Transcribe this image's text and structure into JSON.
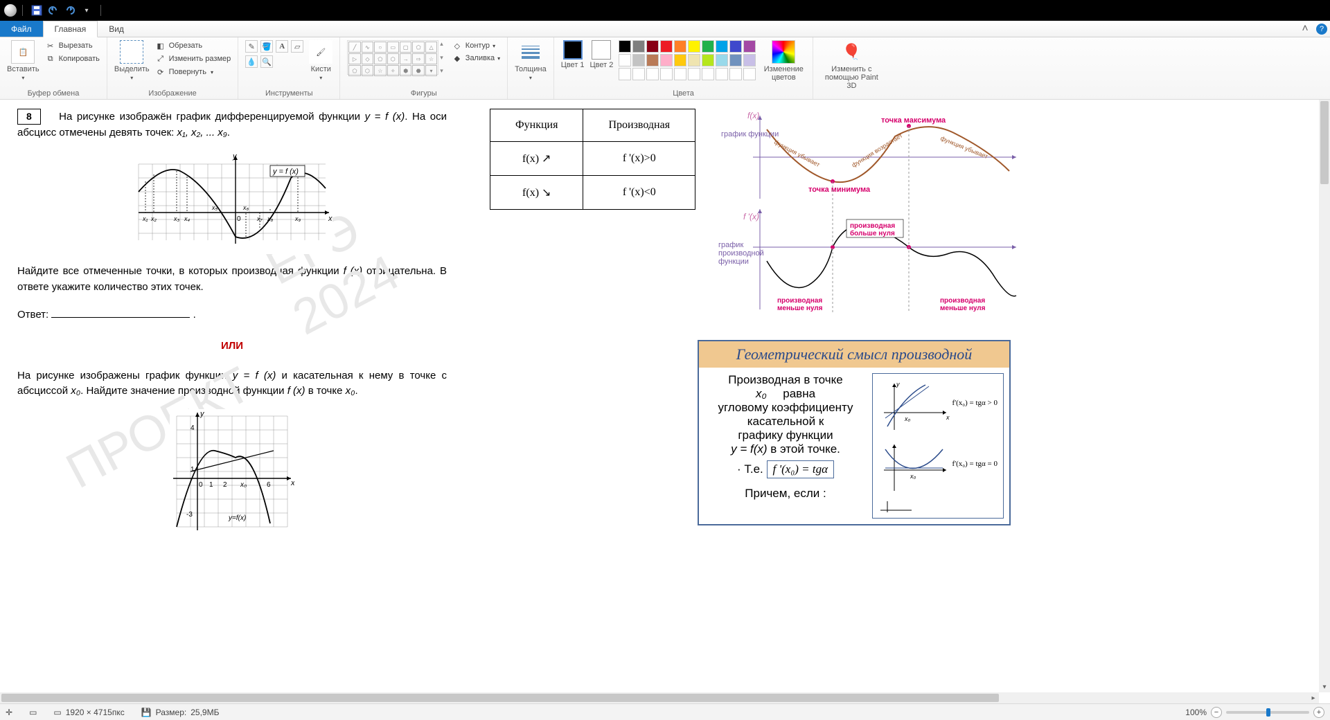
{
  "titlebar": {
    "dd_icon": "▾"
  },
  "tabs": {
    "file": "Файл",
    "home": "Главная",
    "view": "Вид",
    "minimize_glyph": "˄",
    "help_glyph": "?"
  },
  "ribbon": {
    "clipboard": {
      "paste": "Вставить",
      "cut": "Вырезать",
      "copy": "Копировать",
      "group": "Буфер обмена"
    },
    "image": {
      "select": "Выделить",
      "crop": "Обрезать",
      "resize": "Изменить размер",
      "rotate": "Повернуть",
      "group": "Изображение"
    },
    "tools": {
      "group": "Инструменты",
      "brush": "Кисти"
    },
    "shapes": {
      "group": "Фигуры",
      "outline": "Контур",
      "fill": "Заливка"
    },
    "size": {
      "label": "Толщина"
    },
    "colors": {
      "c1": "Цвет 1",
      "c2": "Цвет 2",
      "edit": "Изменение цветов",
      "group": "Цвета"
    },
    "paint3d": {
      "label": "Изменить с помощью Paint 3D"
    }
  },
  "palette": [
    "#000000",
    "#7f7f7f",
    "#880015",
    "#ed1c24",
    "#ff7f27",
    "#fff200",
    "#22b14c",
    "#00a2e8",
    "#3f48cc",
    "#a349a4",
    "#ffffff",
    "#c3c3c3",
    "#b97a57",
    "#ffaec9",
    "#ffc90e",
    "#efe4b0",
    "#b5e61d",
    "#99d9ea",
    "#7092be",
    "#c8bfe7"
  ],
  "doc": {
    "num": "8",
    "p1a": "На рисунке изображён график дифференцируемой функции ",
    "p1f": "y = f (x)",
    "p1b": ". На оси абсцисс отмечены девять точек: ",
    "p1pts": "x₁, x₂, ... x₉",
    "p1c": ".",
    "graph_label": "y = f (x)",
    "pts": [
      "x₁",
      "x₂",
      "x₃",
      "x₄",
      "x₅",
      "x₆",
      "x₇",
      "x₈",
      "x₉"
    ],
    "axis_x": "x",
    "axis_y": "y",
    "origin": "0",
    "p2a": "Найдите все отмеченные точки, в которых производная функции ",
    "p2f": "f (x)",
    "p2b": " отрицательна. В ответе укажите количество этих точек.",
    "answer": "Ответ:",
    "ili": "ИЛИ",
    "p3a": "На рисунке изображены график функции ",
    "p3f": "y = f (x)",
    "p3b": " и касательная к нему в точке с абсциссой ",
    "p3x0": "x₀",
    "p3c": ". Найдите значение производной функции ",
    "p3f2": "f (x)",
    "p3d": " в точке ",
    "p3x02": "x₀",
    "p3e": ".",
    "g2": {
      "ticks_y": [
        "4",
        "1",
        "-3"
      ],
      "ticks_x": [
        "0",
        "1",
        "2",
        "x₀",
        "6"
      ],
      "lab": "y=f(x)"
    },
    "watermark": "ЕГЭ 2024",
    "watermark2": "ПРОЕКТ"
  },
  "table": {
    "h1": "Функция",
    "h2": "Производная",
    "r1c1": "f(x) ↗",
    "r1c2": "f '(x)>0",
    "r2c1": "f(x) ↘",
    "r2c2": "f '(x)<0"
  },
  "diagram": {
    "fx": "f(x)",
    "gfx": "график функции",
    "fpx": "f '(x)",
    "gfpx": "график производной функции",
    "tmax": "точка максимума",
    "tmin": "точка минимума",
    "asc": "функция возрастает",
    "desc": "функция убывает",
    "pgt": "производная больше нуля",
    "plt": "производная меньше нуля"
  },
  "card": {
    "title": "Геометрический смысл производной",
    "l1": "Производная в точке",
    "x0": "x₀",
    "l2": "равна",
    "l3": "угловому коэффициенту",
    "l4": "касательной к",
    "l5": "графику функции",
    "l6a": "y = f(x)",
    "l6b": " в этой точке.",
    "te": "Т.е.",
    "formula": "f '(x₀) = tgα",
    "bottom": "Причем, если :",
    "g1": "f'(x₀) = tgα > 0",
    "g2": "f'(x₀) = tgα = 0"
  },
  "status": {
    "dims": "1920 × 4715пкс",
    "size_label": "Размер: ",
    "size": "25,9МБ",
    "zoom": "100%"
  }
}
